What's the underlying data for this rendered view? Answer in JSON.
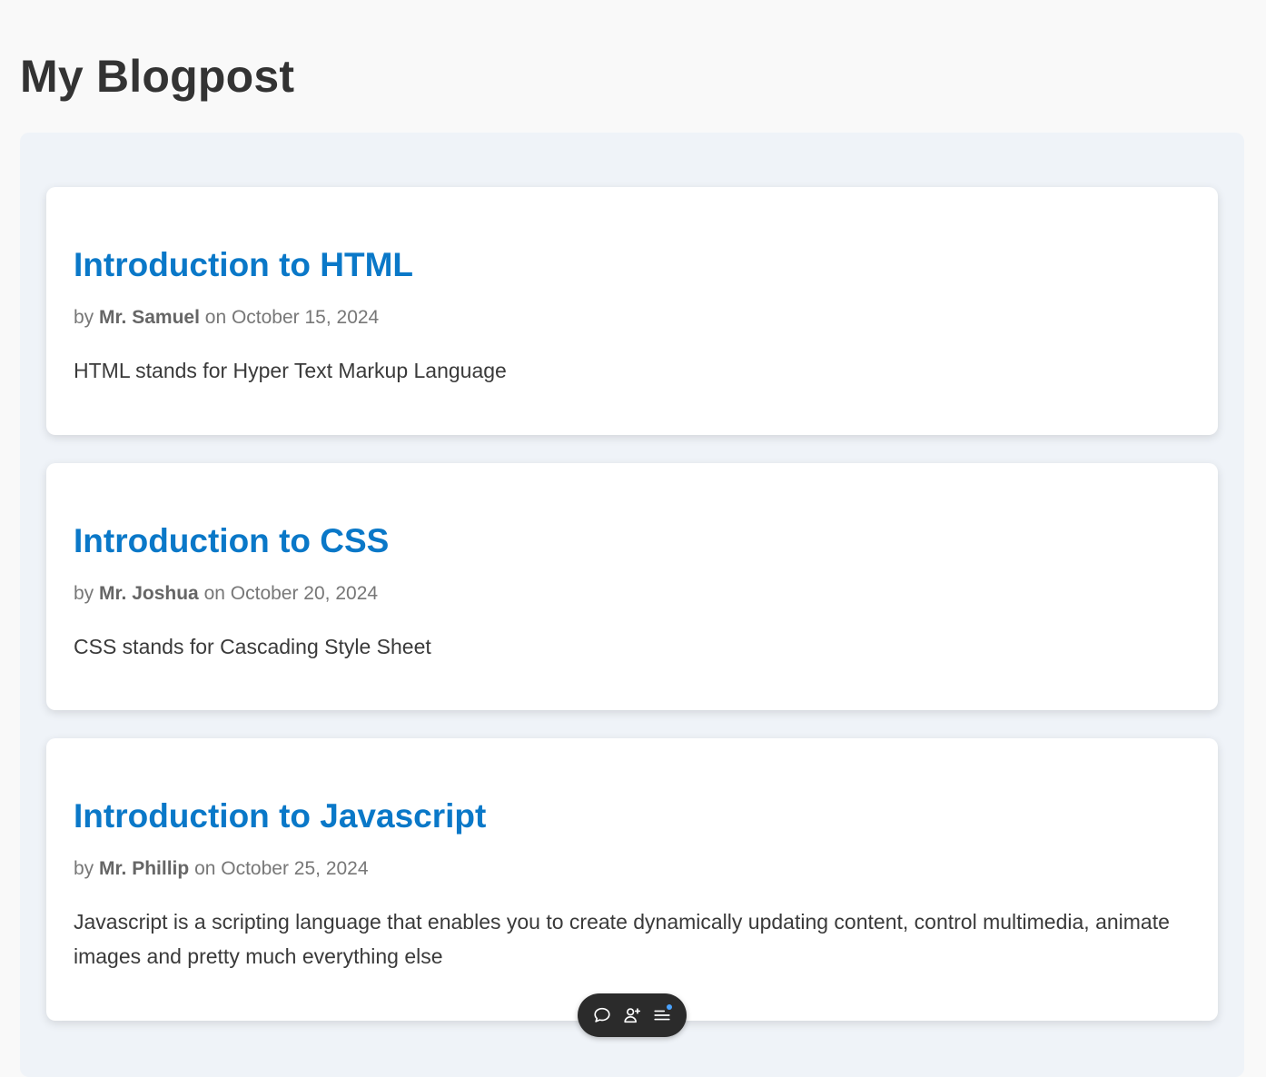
{
  "page": {
    "title": "My Blogpost"
  },
  "posts": [
    {
      "title": "Introduction to HTML",
      "by": "by",
      "author": "Mr. Samuel",
      "on": "on October 15, 2024",
      "body": "HTML stands for Hyper Text Markup Language"
    },
    {
      "title": "Introduction to CSS",
      "by": "by",
      "author": "Mr. Joshua",
      "on": "on October 20, 2024",
      "body": "CSS stands for Cascading Style Sheet"
    },
    {
      "title": "Introduction to Javascript",
      "by": "by",
      "author": "Mr. Phillip",
      "on": "on October 25, 2024",
      "body": "Javascript is a scripting language that enables you to create dynamically updating content, control multimedia, animate images and pretty much everything else"
    }
  ],
  "toolbar": {
    "icons": [
      "chat-bubble-icon",
      "add-user-icon",
      "menu-list-icon"
    ],
    "notification_color": "#4aa3ff"
  },
  "colors": {
    "page_bg": "#f9f9f9",
    "container_bg": "#eff3f8",
    "card_bg": "#ffffff",
    "title_link": "#0a78c8",
    "meta_text": "#777777",
    "toolbar_bg": "#2b2b2b"
  }
}
